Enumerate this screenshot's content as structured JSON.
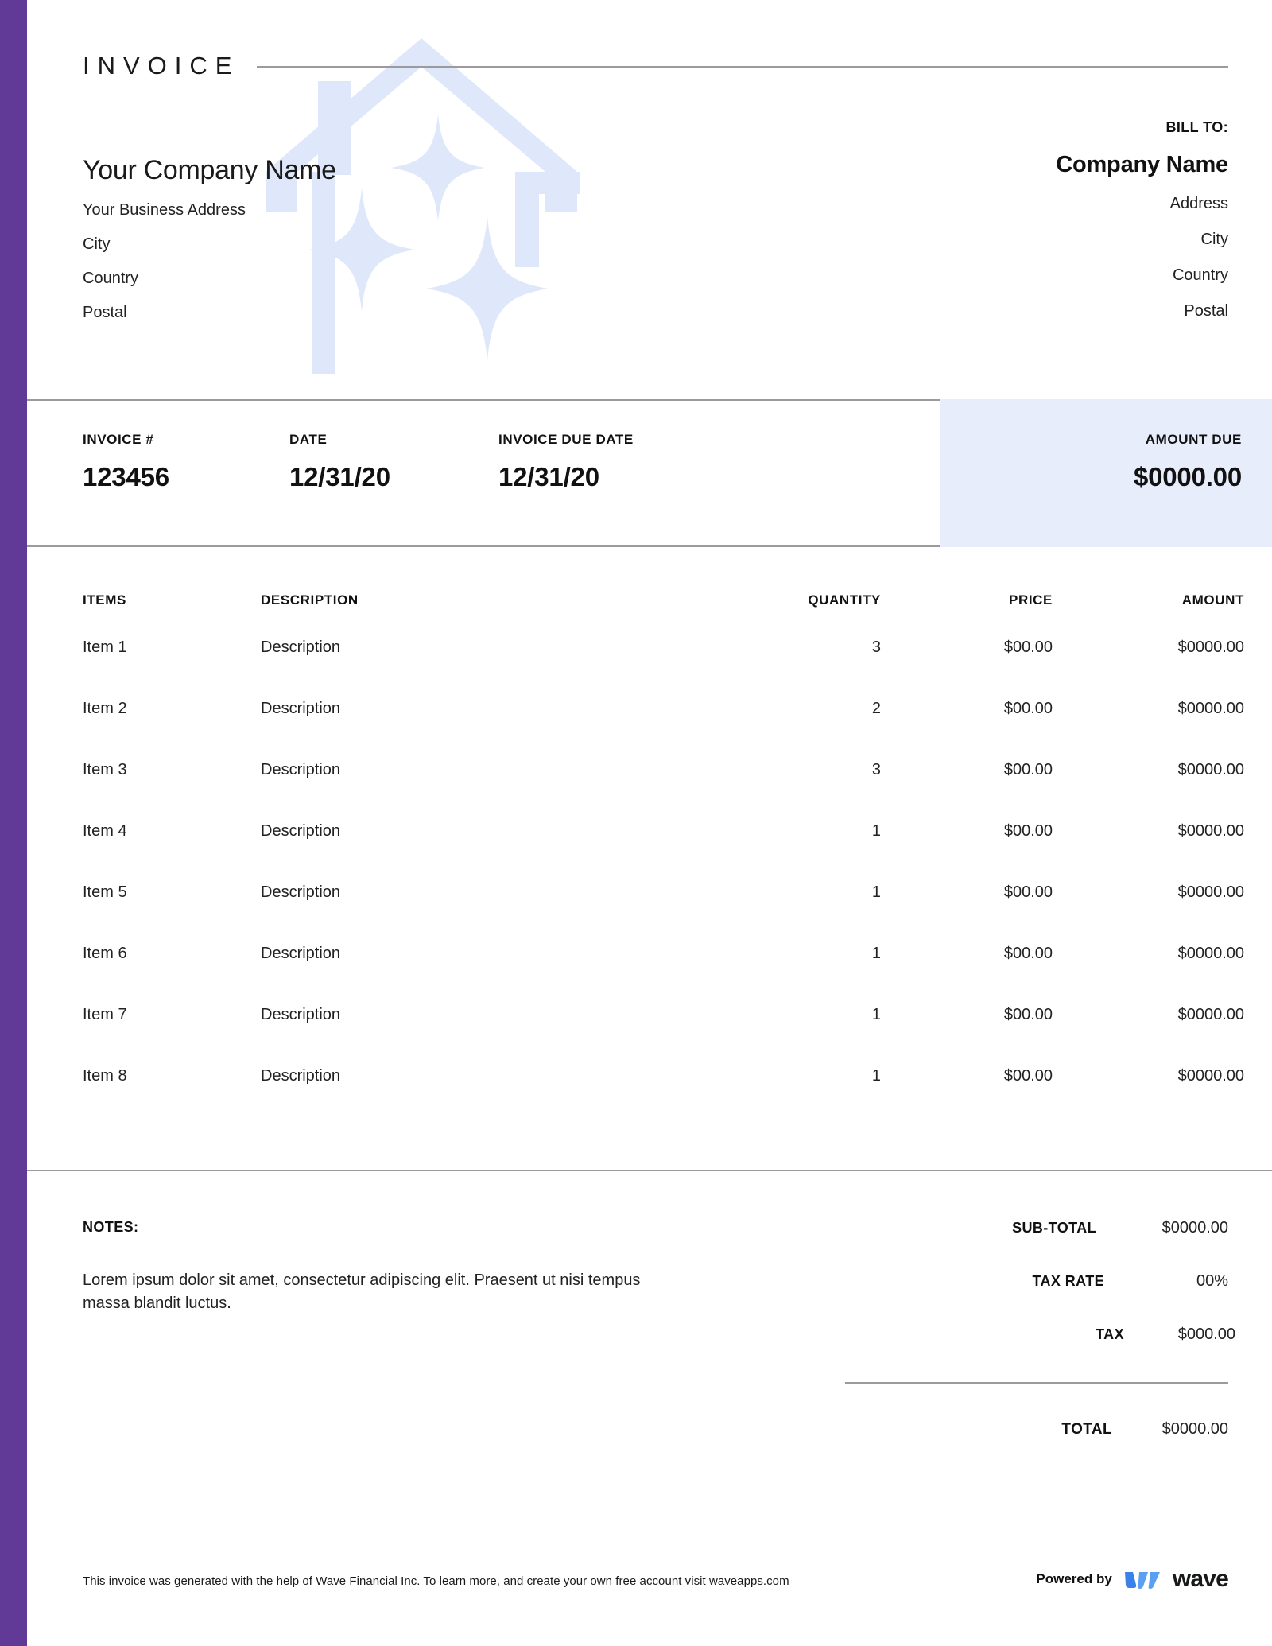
{
  "document": {
    "title_word": "INVOICE"
  },
  "sender": {
    "company_name": "Your Company Name",
    "address": "Your Business Address",
    "city": "City",
    "country": "Country",
    "postal": "Postal"
  },
  "bill_to": {
    "label": "BILL TO:",
    "company_name": "Company Name",
    "address": "Address",
    "city": "City",
    "country": "Country",
    "postal": "Postal"
  },
  "details": {
    "invoice_number_label": "INVOICE #",
    "invoice_number": "123456",
    "date_label": "DATE",
    "date": "12/31/20",
    "due_date_label": "INVOICE DUE DATE",
    "due_date": "12/31/20",
    "amount_due_label": "AMOUNT DUE",
    "amount_due": "$0000.00"
  },
  "table": {
    "headers": {
      "items": "ITEMS",
      "description": "DESCRIPTION",
      "quantity": "QUANTITY",
      "price": "PRICE",
      "amount": "AMOUNT"
    },
    "rows": [
      {
        "item": "Item 1",
        "description": "Description",
        "quantity": "3",
        "price": "$00.00",
        "amount": "$0000.00"
      },
      {
        "item": "Item 2",
        "description": "Description",
        "quantity": "2",
        "price": "$00.00",
        "amount": "$0000.00"
      },
      {
        "item": "Item 3",
        "description": "Description",
        "quantity": "3",
        "price": "$00.00",
        "amount": "$0000.00"
      },
      {
        "item": "Item 4",
        "description": "Description",
        "quantity": "1",
        "price": "$00.00",
        "amount": "$0000.00"
      },
      {
        "item": "Item 5",
        "description": "Description",
        "quantity": "1",
        "price": "$00.00",
        "amount": "$0000.00"
      },
      {
        "item": "Item 6",
        "description": "Description",
        "quantity": "1",
        "price": "$00.00",
        "amount": "$0000.00"
      },
      {
        "item": "Item 7",
        "description": "Description",
        "quantity": "1",
        "price": "$00.00",
        "amount": "$0000.00"
      },
      {
        "item": "Item 8",
        "description": "Description",
        "quantity": "1",
        "price": "$00.00",
        "amount": "$0000.00"
      }
    ]
  },
  "notes": {
    "label": "NOTES:",
    "text": "Lorem ipsum dolor sit amet, consectetur adipiscing elit. Praesent ut nisi tempus massa blandit luctus."
  },
  "totals": {
    "subtotal_label": "SUB-TOTAL",
    "subtotal_value": "$0000.00",
    "tax_rate_label": "TAX RATE",
    "tax_rate_value": "00%",
    "tax_label": "TAX",
    "tax_value": "$000.00",
    "total_label": "TOTAL",
    "total_value": "$0000.00"
  },
  "footer": {
    "text_before_link": "This invoice was generated with the help of Wave Financial Inc. To learn more, and create your own free account visit ",
    "link_text": "waveapps.com",
    "powered_by_label": "Powered by",
    "brand_name": "wave"
  },
  "colors": {
    "accent_purple": "#613a98",
    "amount_due_panel": "#e7edfb",
    "watermark": "#dfe7fa",
    "rule": "#9b9b9b",
    "wave_blue_dark": "#3a82e8",
    "wave_blue_light": "#5aa0f2"
  }
}
